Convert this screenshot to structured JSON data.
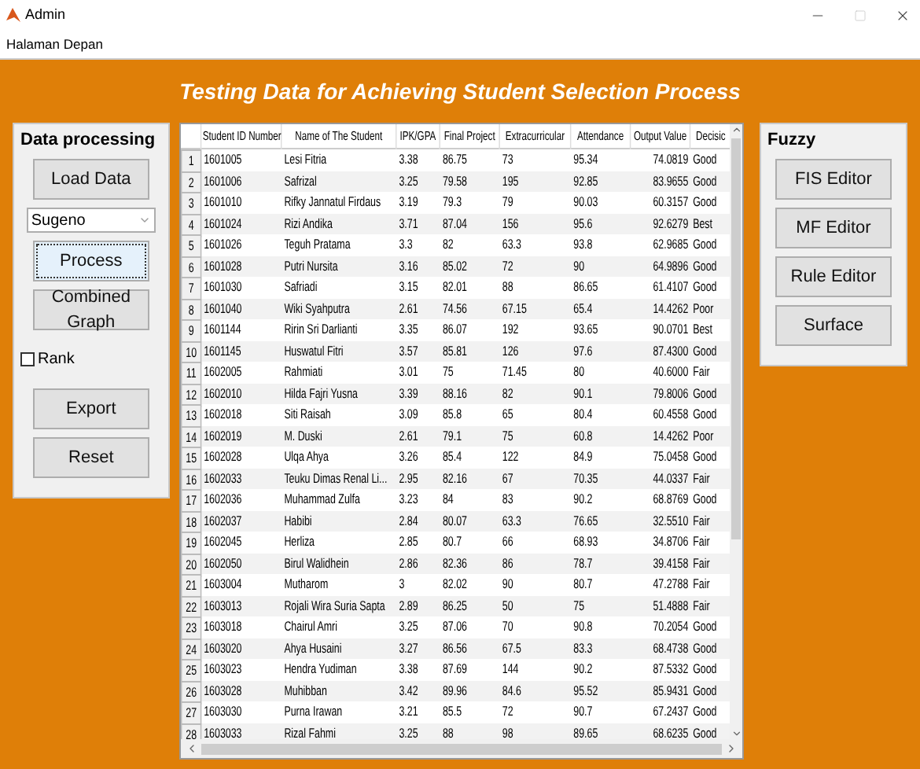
{
  "window": {
    "title": "Admin"
  },
  "menu": [
    "Halaman Depan"
  ],
  "heading": "Testing Data for Achieving Student Selection Process",
  "data_panel": {
    "title": "Data processing",
    "items": [
      {
        "kind": "button",
        "label": "Load Data",
        "focused": false
      },
      {
        "kind": "select",
        "value": "Sugeno"
      },
      {
        "kind": "button",
        "label": "Process",
        "focused": true
      },
      {
        "kind": "button",
        "label": "Combined Graph",
        "focused": false
      },
      {
        "kind": "checkbox",
        "label": "Rank",
        "checked": false
      },
      {
        "kind": "button",
        "label": "Export",
        "focused": false
      },
      {
        "kind": "button",
        "label": "Reset",
        "focused": false
      }
    ]
  },
  "table": {
    "columns": [
      "Student ID Number",
      "Name of The Student",
      "IPK/GPA",
      "Final Project",
      "Extracurricular",
      "Attendance",
      "Output Value",
      "Decisic"
    ],
    "rows": [
      {
        "number": "1",
        "cells": [
          "1601005",
          "Lesi Fitria",
          "3.38",
          "86.75",
          "73",
          "95.34",
          "74.0819",
          "Good"
        ]
      },
      {
        "number": "2",
        "cells": [
          "1601006",
          "Safrizal",
          "3.25",
          "79.58",
          "195",
          "92.85",
          "83.9655",
          "Good"
        ]
      },
      {
        "number": "3",
        "cells": [
          "1601010",
          "Rifky Jannatul Firdaus",
          "3.19",
          "79.3",
          "79",
          "90.03",
          "60.3157",
          "Good"
        ]
      },
      {
        "number": "4",
        "cells": [
          "1601024",
          "Rizi Andika",
          "3.71",
          "87.04",
          "156",
          "95.6",
          "92.6279",
          "Best"
        ]
      },
      {
        "number": "5",
        "cells": [
          "1601026",
          "Teguh Pratama",
          "3.3",
          "82",
          "63.3",
          "93.8",
          "62.9685",
          "Good"
        ]
      },
      {
        "number": "6",
        "cells": [
          "1601028",
          "Putri Nursita",
          "3.16",
          "85.02",
          "72",
          "90",
          "64.9896",
          "Good"
        ]
      },
      {
        "number": "7",
        "cells": [
          "1601030",
          "Safriadi",
          "3.15",
          "82.01",
          "88",
          "86.65",
          "61.4107",
          "Good"
        ]
      },
      {
        "number": "8",
        "cells": [
          "1601040",
          "Wiki Syahputra",
          "2.61",
          "74.56",
          "67.15",
          "65.4",
          "14.4262",
          "Poor"
        ]
      },
      {
        "number": "9",
        "cells": [
          "1601144",
          "Ririn Sri Darlianti",
          "3.35",
          "86.07",
          "192",
          "93.65",
          "90.0701",
          "Best"
        ]
      },
      {
        "number": "10",
        "cells": [
          "1601145",
          "Huswatul Fitri",
          "3.57",
          "85.81",
          "126",
          "97.6",
          "87.4300",
          "Good"
        ]
      },
      {
        "number": "11",
        "cells": [
          "1602005",
          "Rahmiati",
          "3.01",
          "75",
          "71.45",
          "80",
          "40.6000",
          "Fair"
        ]
      },
      {
        "number": "12",
        "cells": [
          "1602010",
          "Hilda Fajri Yusna",
          "3.39",
          "88.16",
          "82",
          "90.1",
          "79.8006",
          "Good"
        ]
      },
      {
        "number": "13",
        "cells": [
          "1602018",
          "Siti Raisah",
          "3.09",
          "85.8",
          "65",
          "80.4",
          "60.4558",
          "Good"
        ]
      },
      {
        "number": "14",
        "cells": [
          "1602019",
          "M. Duski",
          "2.61",
          "79.1",
          "75",
          "60.8",
          "14.4262",
          "Poor"
        ]
      },
      {
        "number": "15",
        "cells": [
          "1602028",
          "Ulqa Ahya",
          "3.26",
          "85.4",
          "122",
          "84.9",
          "75.0458",
          "Good"
        ]
      },
      {
        "number": "16",
        "cells": [
          "1602033",
          "Teuku Dimas Renal Li...",
          "2.95",
          "82.16",
          "67",
          "70.35",
          "44.0337",
          "Fair"
        ]
      },
      {
        "number": "17",
        "cells": [
          "1602036",
          "Muhammad Zulfa",
          "3.23",
          "84",
          "83",
          "90.2",
          "68.8769",
          "Good"
        ]
      },
      {
        "number": "18",
        "cells": [
          "1602037",
          "Habibi",
          "2.84",
          "80.07",
          "63.3",
          "76.65",
          "32.5510",
          "Fair"
        ]
      },
      {
        "number": "19",
        "cells": [
          "1602045",
          "Herliza",
          "2.85",
          "80.7",
          "66",
          "68.93",
          "34.8706",
          "Fair"
        ]
      },
      {
        "number": "20",
        "cells": [
          "1602050",
          "Birul Walidhein",
          "2.86",
          "82.36",
          "86",
          "78.7",
          "39.4158",
          "Fair"
        ]
      },
      {
        "number": "21",
        "cells": [
          "1603004",
          "Mutharom",
          "3",
          "82.02",
          "90",
          "80.7",
          "47.2788",
          "Fair"
        ]
      },
      {
        "number": "22",
        "cells": [
          "1603013",
          "Rojali Wira Suria Sapta",
          "2.89",
          "86.25",
          "50",
          "75",
          "51.4888",
          "Fair"
        ]
      },
      {
        "number": "23",
        "cells": [
          "1603018",
          "Chairul Amri",
          "3.25",
          "87.06",
          "70",
          "90.8",
          "70.2054",
          "Good"
        ]
      },
      {
        "number": "24",
        "cells": [
          "1603020",
          "Ahya Husaini",
          "3.27",
          "86.56",
          "67.5",
          "83.3",
          "68.4738",
          "Good"
        ]
      },
      {
        "number": "25",
        "cells": [
          "1603023",
          "Hendra Yudiman",
          "3.38",
          "87.69",
          "144",
          "90.2",
          "87.5332",
          "Good"
        ]
      },
      {
        "number": "26",
        "cells": [
          "1603028",
          "Muhibban",
          "3.42",
          "89.96",
          "84.6",
          "95.52",
          "85.9431",
          "Good"
        ]
      },
      {
        "number": "27",
        "cells": [
          "1603030",
          "Purna Irawan",
          "3.21",
          "85.5",
          "72",
          "90.7",
          "67.2437",
          "Good"
        ]
      },
      {
        "number": "28",
        "cells": [
          "1603033",
          "Rizal Fahmi",
          "3.25",
          "88",
          "98",
          "89.65",
          "68.6235",
          "Good"
        ]
      }
    ]
  },
  "fuzzy_panel": {
    "title": "Fuzzy",
    "buttons": [
      "FIS Editor",
      "MF Editor",
      "Rule Editor",
      "Surface"
    ]
  }
}
